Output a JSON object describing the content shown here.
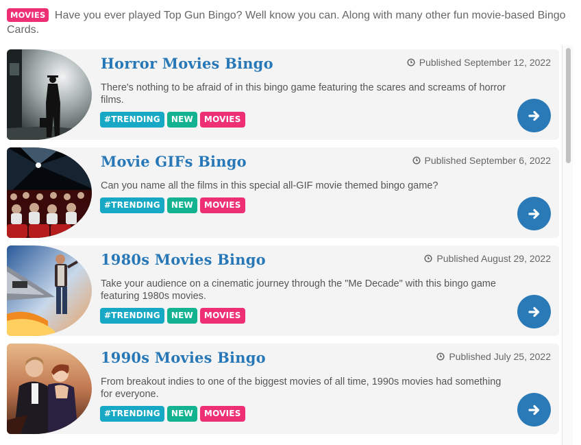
{
  "intro": {
    "badge": "MOVIES",
    "text": "Have you ever played Top Gun Bingo? Well know you can. Along with many other fun movie-based Bingo Cards."
  },
  "cards": [
    {
      "title": "Horror Movies Bingo",
      "date": "Published September 12, 2022",
      "desc": "There's nothing to be afraid of in this bingo game featuring the scares and screams of horror films.",
      "tags": [
        "#TRENDING",
        "NEW",
        "MOVIES"
      ],
      "image": "horror-movie-poster"
    },
    {
      "title": "Movie GIFs Bingo",
      "date": "Published September 6, 2022",
      "desc": "Can you name all the films in this special all-GIF movie themed bingo game?",
      "tags": [
        "#TRENDING",
        "NEW",
        "MOVIES"
      ],
      "image": "movie-theater-audience"
    },
    {
      "title": "1980s Movies Bingo",
      "date": "Published August 29, 2022",
      "desc": "Take your audience on a cinematic journey through the \"Me Decade\" with this bingo game featuring 1980s movies.",
      "tags": [
        "#TRENDING",
        "NEW",
        "MOVIES"
      ],
      "image": "back-to-the-future-poster"
    },
    {
      "title": "1990s Movies Bingo",
      "date": "Published July 25, 2022",
      "desc": "From breakout indies to one of the biggest movies of all time, 1990s movies had something for everyone.",
      "tags": [
        "#TRENDING",
        "NEW",
        "MOVIES"
      ],
      "image": "titanic-poster"
    }
  ],
  "icons": {
    "date": "clock-icon",
    "open": "arrow-right-icon"
  },
  "colors": {
    "accent": "#2a7ab8",
    "movies": "#ef2f73",
    "trending": "#16a8c4",
    "new": "#13b392"
  }
}
